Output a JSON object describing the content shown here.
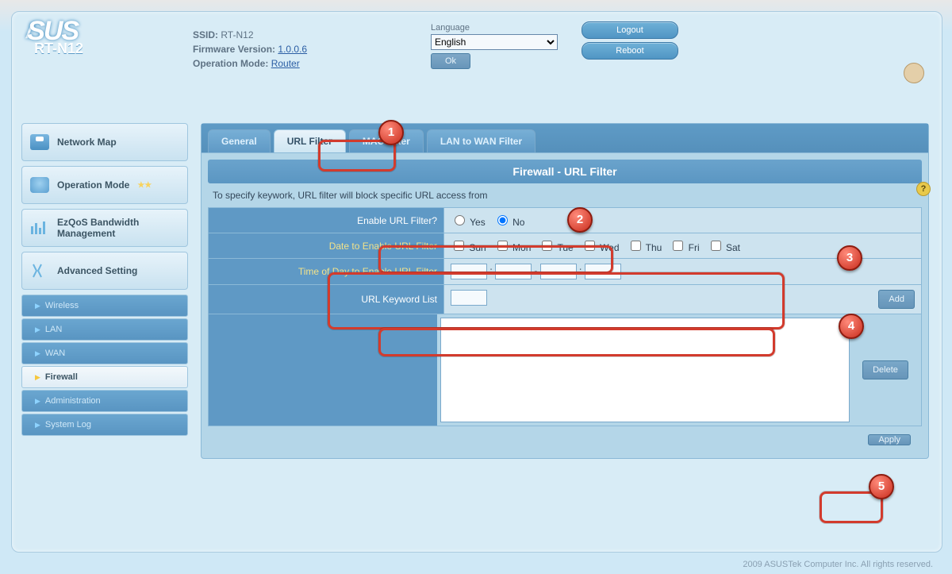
{
  "header": {
    "brand": "/SUS",
    "model": "RT-N12",
    "ssid_label": "SSID:",
    "ssid": "RT-N12",
    "fw_label": "Firmware Version:",
    "fw": "1.0.0.6",
    "opmode_label": "Operation Mode:",
    "opmode": "Router",
    "lang_label": "Language",
    "lang_value": "English",
    "logout": "Logout",
    "reboot": "Reboot",
    "ok": "Ok"
  },
  "nav": {
    "items": [
      {
        "label": "Network Map"
      },
      {
        "label": "Operation Mode"
      },
      {
        "label": "EzQoS Bandwidth Management"
      },
      {
        "label": "Advanced Setting"
      }
    ],
    "sub": [
      {
        "label": "Wireless"
      },
      {
        "label": "LAN"
      },
      {
        "label": "WAN"
      },
      {
        "label": "Firewall"
      },
      {
        "label": "Administration"
      },
      {
        "label": "System Log"
      }
    ]
  },
  "tabs": [
    "General",
    "URL Filter",
    "MAC Filter",
    "LAN to WAN Filter"
  ],
  "page": {
    "title": "Firewall - URL Filter",
    "desc": "To specify keywork, URL filter will block specific URL access from",
    "rows": {
      "enable": "Enable URL Filter?",
      "yes": "Yes",
      "no": "No",
      "date": "Date to Enable URL Filter",
      "days": [
        "Sun",
        "Mon",
        "Tue",
        "Wed",
        "Thu",
        "Fri",
        "Sat"
      ],
      "time": "Time of Day to Enable URL Filter",
      "kw": "URL Keyword List",
      "add": "Add",
      "delete": "Delete",
      "apply": "Apply"
    }
  },
  "footer": "2009 ASUSTek Computer Inc. All rights reserved."
}
